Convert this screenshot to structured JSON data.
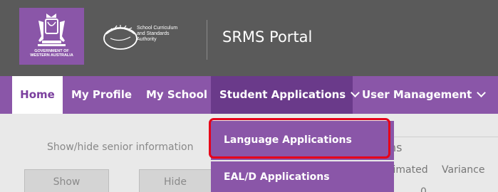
{
  "header": {
    "crest_text": "GOVERNMENT OF WESTERN AUSTRALIA",
    "crest_line1": "GOVERNMENT OF",
    "crest_line2": "WESTERN AUSTRALIA",
    "scsa_line1": "School Curriculum",
    "scsa_line2": "and Standards",
    "scsa_line3": "Authority",
    "portal_title": "SRMS Portal"
  },
  "nav": {
    "home": "Home",
    "my_profile": "My Profile",
    "my_school": "My School",
    "student_applications": "Student Applications",
    "user_management": "User Management"
  },
  "dropdown": {
    "language_applications": "Language Applications",
    "eald_applications": "EAL/D Applications"
  },
  "content": {
    "show_hide_label": "Show/hide senior information",
    "show_button": "Show",
    "hide_button": "Hide",
    "right_heading_fragment": "ns",
    "col_estimated_fragment": "timated",
    "col_variance": "Variance",
    "value_fragment": "0"
  },
  "colors": {
    "header_bg": "#5a5a5a",
    "nav_bg": "#8a56a8",
    "nav_active_bg": "#6a3a8a",
    "highlight": "#e6001a"
  }
}
